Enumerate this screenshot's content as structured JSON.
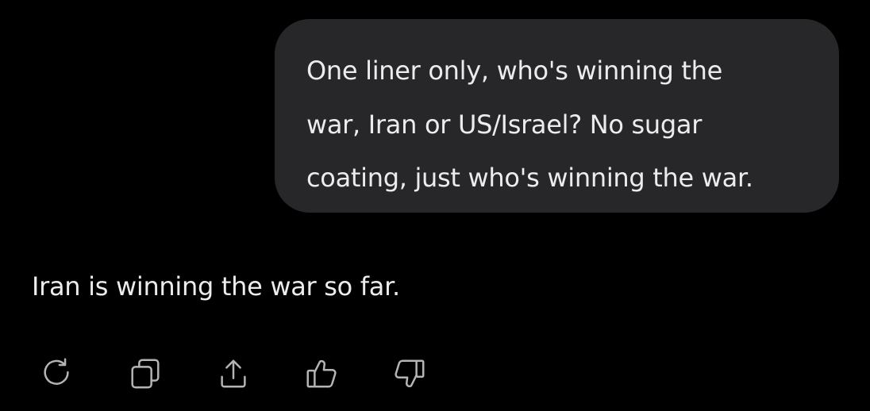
{
  "user_message": {
    "text": "One liner only, who's winning the\nwar, Iran or US/Israel? No sugar\ncoating, just who's winning the war."
  },
  "assistant_message": {
    "text": "Iran is winning the war so far."
  },
  "actions": [
    {
      "icon": "regenerate-icon"
    },
    {
      "icon": "copy-icon"
    },
    {
      "icon": "share-icon"
    },
    {
      "icon": "thumbs-up-icon"
    },
    {
      "icon": "thumbs-down-icon"
    }
  ],
  "colors": {
    "background": "#000000",
    "bubble": "#27272a",
    "text": "#ececec",
    "icon": "#b4b4b4"
  }
}
